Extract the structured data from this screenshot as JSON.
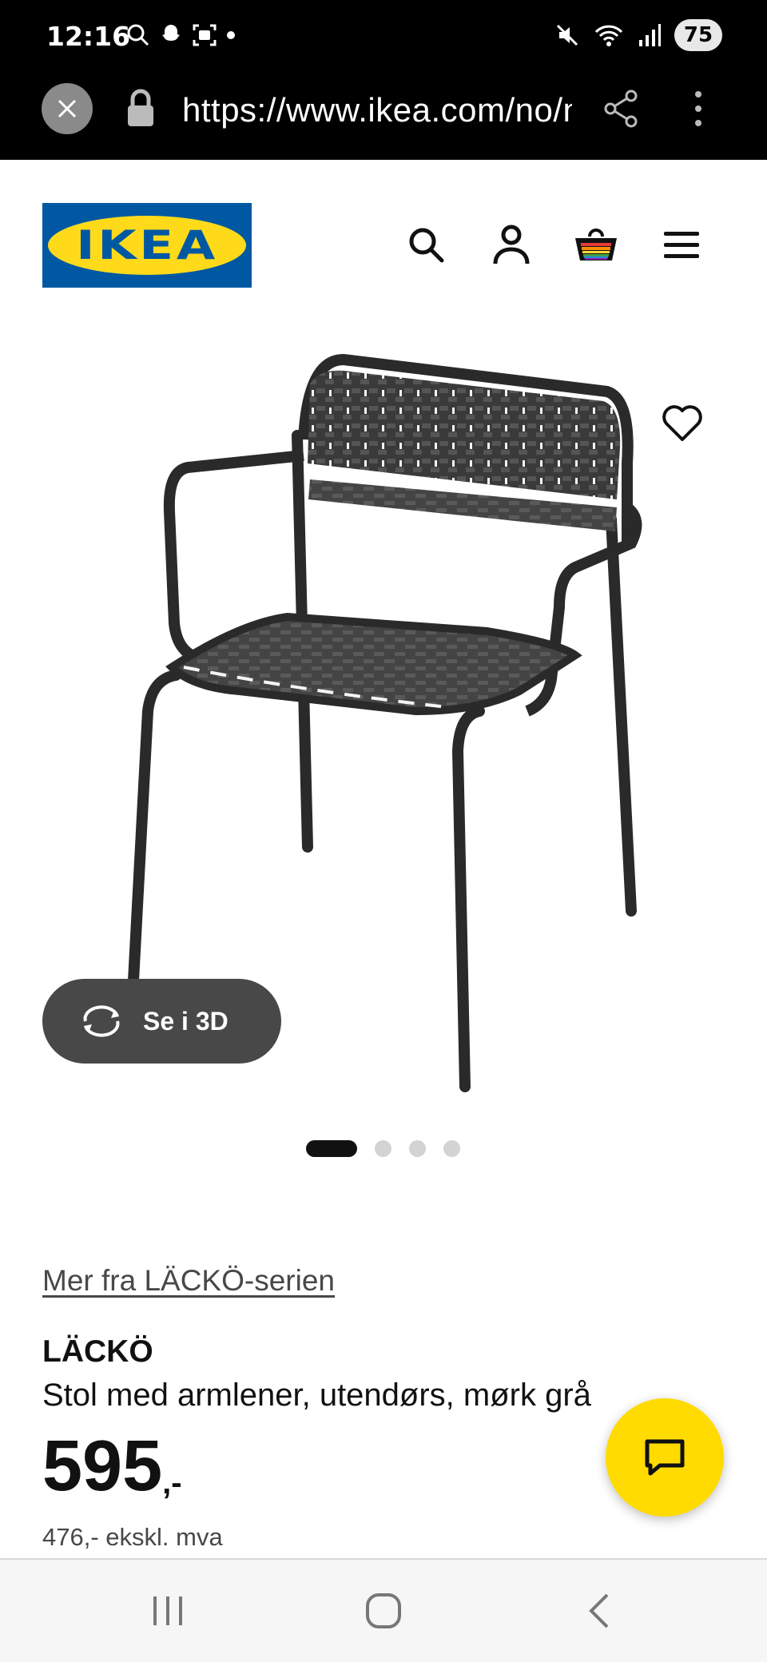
{
  "status_bar": {
    "time": "12:16",
    "battery": "75",
    "icons_left": [
      "search-icon",
      "snapchat-icon",
      "screenshot-icon",
      "dot-icon"
    ],
    "icons_right": [
      "mute-icon",
      "wifi-icon",
      "signal-icon"
    ]
  },
  "browser": {
    "url": "https://www.ikea.com/no/no/p/lacko",
    "close_icon": "close-icon",
    "share_icon": "share-icon",
    "more_icon": "more-vertical-icon"
  },
  "header": {
    "logo_text": "IKEA",
    "icons": [
      "search-icon",
      "account-icon",
      "cart-icon",
      "menu-icon"
    ]
  },
  "gallery": {
    "button_3d_label": "Se i 3D",
    "image_count": 4,
    "active_index": 0
  },
  "product": {
    "series_link": "Mer fra LÄCKÖ-serien",
    "name": "LÄCKÖ",
    "description": "Stol med armlener, utendørs, mørk grå",
    "price_integer": "595",
    "price_suffix": ",-",
    "price_ex_vat": "476,- ekskl. mva"
  },
  "colors": {
    "ikea_blue": "#0058a3",
    "ikea_yellow": "#ffda1a",
    "chat_yellow": "#ffdb00"
  }
}
